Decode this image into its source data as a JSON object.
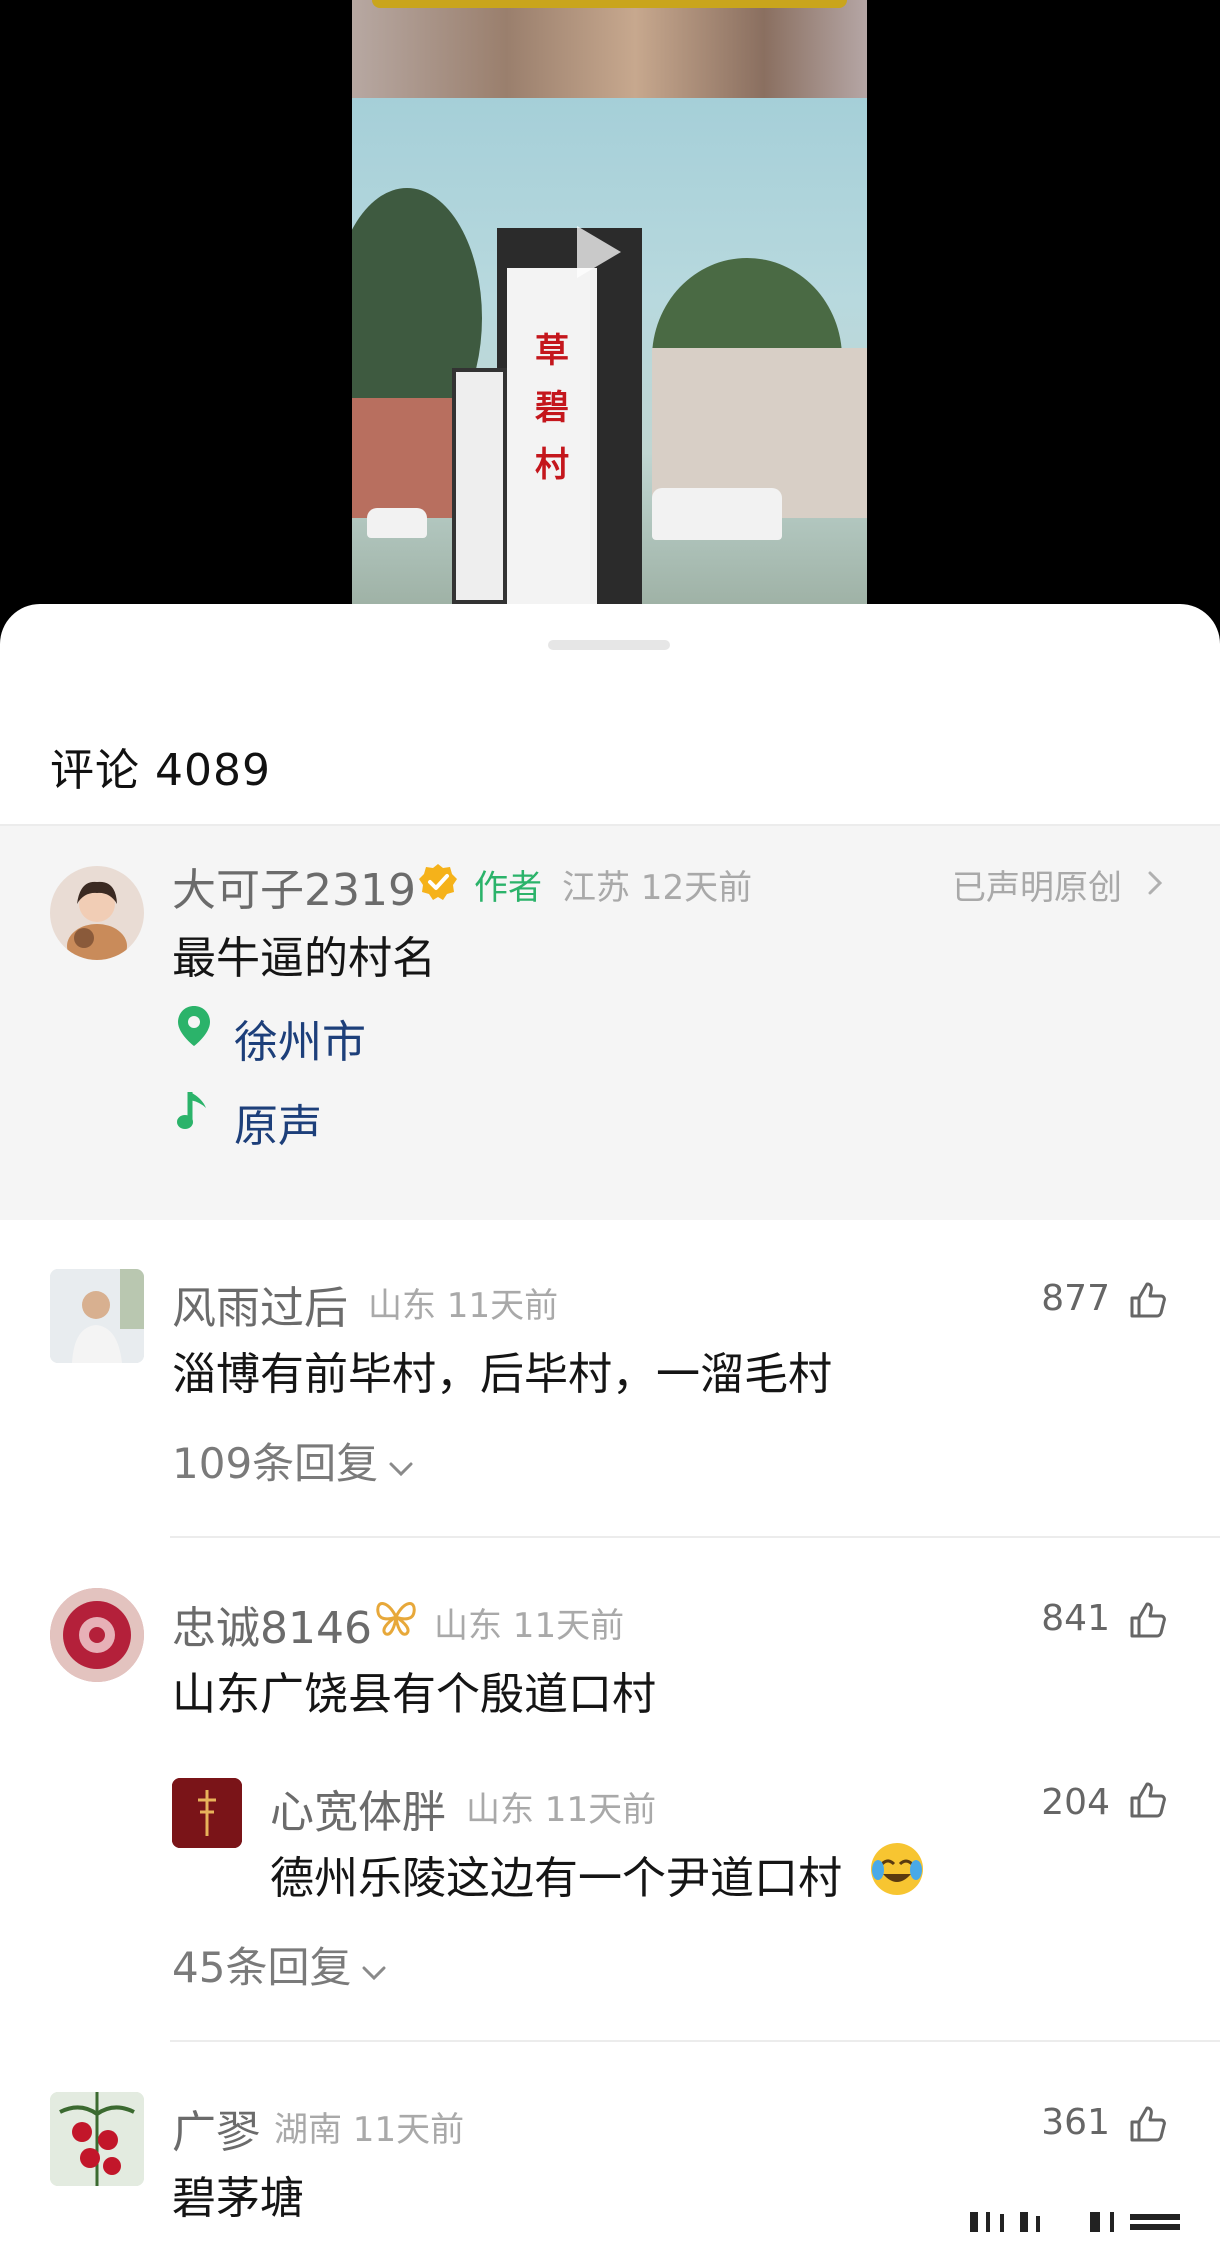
{
  "video": {
    "sign_chars": [
      "草",
      "碧",
      "村"
    ]
  },
  "comments_header": {
    "title": "评论 4089"
  },
  "author_post": {
    "username": "大可子2319",
    "author_badge": "作者",
    "location_time": "江苏 12天前",
    "declared": "已声明原创",
    "text": "最牛逼的村名",
    "location_tag": "徐州市",
    "music_tag": "原声",
    "icons": {
      "verified": "verified-badge-icon",
      "location": "location-pin-icon",
      "music": "music-note-icon",
      "chevron": "chevron-right-icon"
    },
    "accent_color": "#2bb36a",
    "tag_color": "#1d3f7a"
  },
  "comments": [
    {
      "username": "风雨过后",
      "meta": "山东 11天前",
      "text": "淄博有前毕村，后毕村，一溜毛村",
      "likes": "877",
      "replies_label": "109条回复"
    },
    {
      "username": "忠诚8146",
      "meta": "山东 11天前",
      "text": "山东广饶县有个殷道口村",
      "likes": "841",
      "reply": {
        "username": "心宽体胖",
        "meta": "山东 11天前",
        "text": "德州乐陵这边有一个尹道口村",
        "likes": "204"
      },
      "replies_label": "45条回复"
    },
    {
      "username": "广翏",
      "meta": "湖南 11天前",
      "text": "碧茅塘",
      "likes": "361"
    }
  ]
}
